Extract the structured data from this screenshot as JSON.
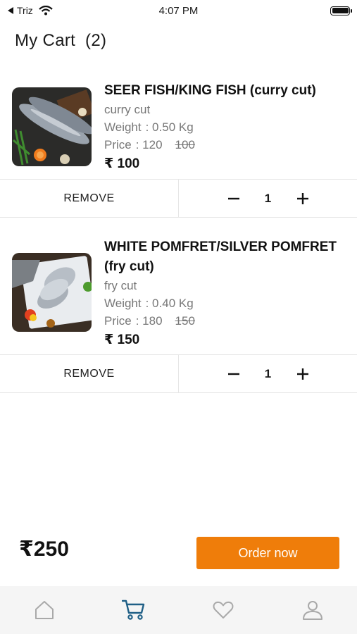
{
  "status_bar": {
    "back_app": "Triz",
    "time": "4:07 PM"
  },
  "header": {
    "title": "My Cart",
    "count": "(2)"
  },
  "items": [
    {
      "name": "SEER FISH/KING FISH (curry cut)",
      "cut": "curry cut",
      "weight_label": "Weight",
      "weight_value": ":  0.50  Kg",
      "price_label": "Price",
      "price_value": ":  120",
      "price_original": "100",
      "final_price": "₹ 100",
      "remove_label": "REMOVE",
      "quantity": "1",
      "image_icon": "seer-fish-image"
    },
    {
      "name": "WHITE POMFRET/SILVER POMFRET (fry cut)",
      "cut": "fry cut",
      "weight_label": "Weight",
      "weight_value": ":  0.40  Kg",
      "price_label": "Price",
      "price_value": ":  180",
      "price_original": "150",
      "final_price": "₹ 150",
      "remove_label": "REMOVE",
      "quantity": "1",
      "image_icon": "pomfret-fish-image"
    }
  ],
  "footer": {
    "total": "₹250",
    "order_label": "Order now"
  },
  "nav": [
    "home-icon",
    "cart-icon",
    "heart-icon",
    "profile-icon"
  ],
  "colors": {
    "accent": "#ef7d0a",
    "active_nav": "#1f5f86",
    "inactive_nav": "#a9a9a9"
  }
}
